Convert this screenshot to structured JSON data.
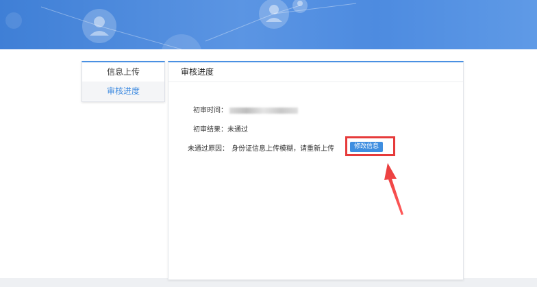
{
  "sidebar": {
    "items": [
      {
        "label": "信息上传"
      },
      {
        "label": "审核进度"
      }
    ]
  },
  "panel": {
    "title": "审核进度",
    "first_review_time_label": "初审时间：",
    "first_review_result_label": "初审结果：",
    "first_review_result_value": "未通过",
    "reject_reason_label": "未通过原因：",
    "reject_reason_value": "身份证信息上传模糊，请重新上传",
    "edit_button_label": "修改信息"
  },
  "colors": {
    "accent": "#3f8ee0",
    "highlight": "#e63a3a",
    "banner": "#4d8be0"
  }
}
